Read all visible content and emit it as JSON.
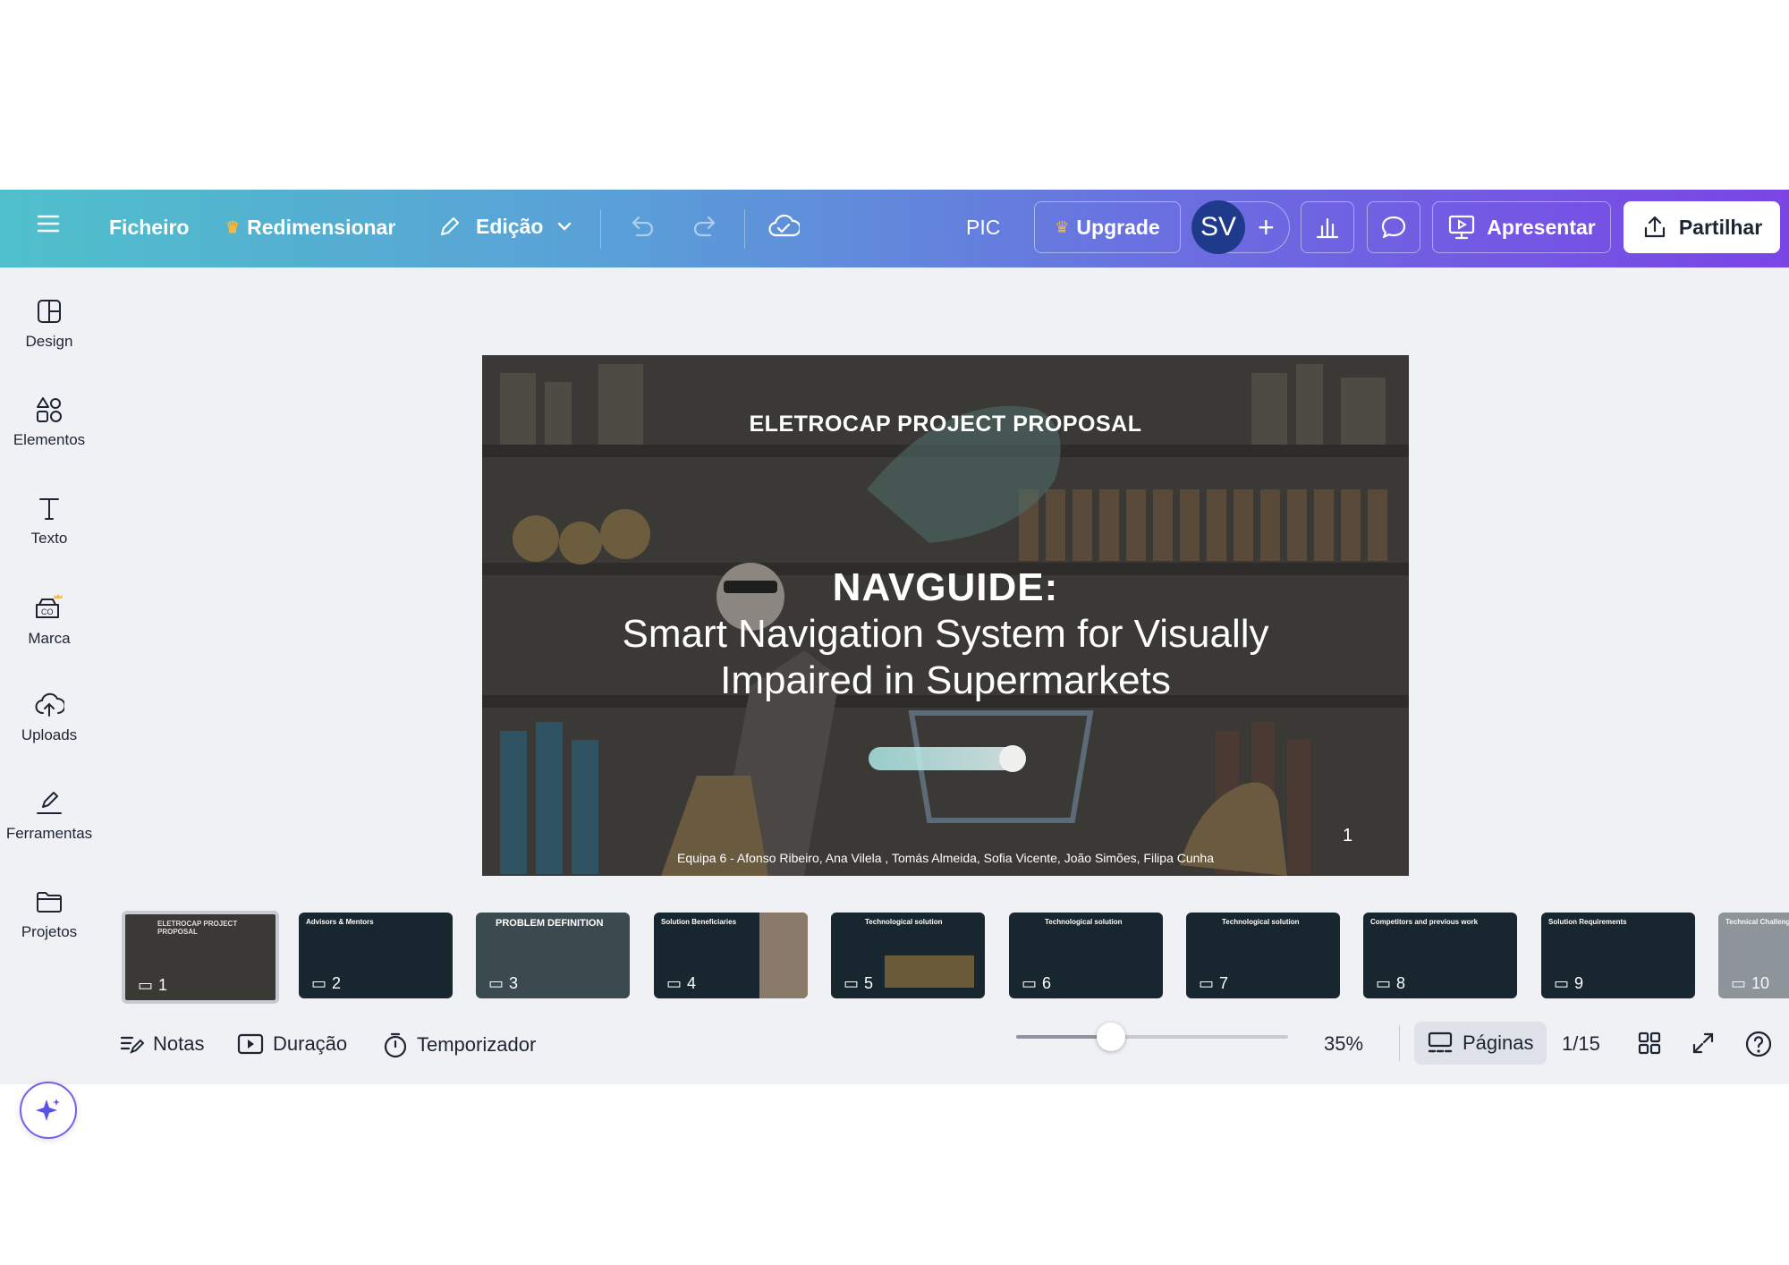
{
  "colors": {
    "accent_start": "#4fc0cb",
    "accent_end": "#7a45e6",
    "avatar": "#1f3a8a",
    "slide_bg": "#3d3b38",
    "thumb_bg": "#17262f"
  },
  "topbar": {
    "menu_icon": "hamburger-icon",
    "file": "Ficheiro",
    "resize": "Redimensionar",
    "edit": "Edição",
    "project_name": "PIC",
    "upgrade": "Upgrade",
    "avatar": "SV",
    "present": "Apresentar",
    "share": "Partilhar"
  },
  "sidebar": {
    "items": [
      {
        "label": "Design",
        "icon": "layout-icon"
      },
      {
        "label": "Elementos",
        "icon": "shapes-icon"
      },
      {
        "label": "Texto",
        "icon": "text-icon"
      },
      {
        "label": "Marca",
        "icon": "brand-icon"
      },
      {
        "label": "Uploads",
        "icon": "cloud-upload-icon"
      },
      {
        "label": "Ferramentas",
        "icon": "pen-tool-icon"
      },
      {
        "label": "Projetos",
        "icon": "folder-icon"
      }
    ]
  },
  "slide": {
    "kicker": "ELETROCAP PROJECT PROPOSAL",
    "title": "NAVGUIDE:",
    "subtitle_1": "Smart Navigation System for Visually",
    "subtitle_2": "Impaired in Supermarkets",
    "authors": "Equipa 6 - Afonso Ribeiro,  Ana Vilela , Tomás Almeida,  Sofia Vicente,  João Simões, Filipa Cunha",
    "page_number": "1"
  },
  "thumbnails": [
    {
      "num": "1",
      "title": "ELETROCAP PROJECT PROPOSAL"
    },
    {
      "num": "2",
      "title": "Advisors & Mentors"
    },
    {
      "num": "3",
      "title": "PROBLEM DEFINITION"
    },
    {
      "num": "4",
      "title": "Solution Beneficiaries"
    },
    {
      "num": "5",
      "title": "Technological solution"
    },
    {
      "num": "6",
      "title": "Technological solution"
    },
    {
      "num": "7",
      "title": "Technological solution"
    },
    {
      "num": "8",
      "title": "Competitors and previous work"
    },
    {
      "num": "9",
      "title": "Solution Requirements"
    },
    {
      "num": "10",
      "title": "Technical Challenges"
    }
  ],
  "bottombar": {
    "notes": "Notas",
    "duration": "Duração",
    "timer": "Temporizador",
    "zoom": "35%",
    "zoom_level": 0.35,
    "pages": "Páginas",
    "page_count": "1/15"
  }
}
